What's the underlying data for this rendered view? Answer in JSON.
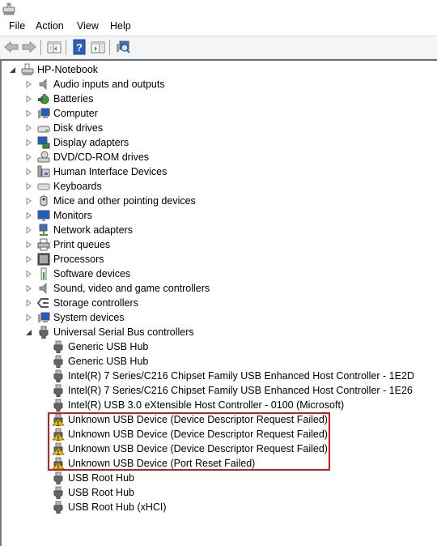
{
  "window": {
    "icon": "device-manager-icon"
  },
  "menu": [
    "File",
    "Action",
    "View",
    "Help"
  ],
  "toolbar": {
    "buttons": [
      {
        "name": "back-button",
        "icon": "back-arrow-icon"
      },
      {
        "name": "forward-button",
        "icon": "forward-arrow-icon"
      },
      {
        "name": "show-hide-console-tree-button",
        "icon": "console-tree-icon"
      },
      {
        "name": "help-button",
        "icon": "help-icon"
      },
      {
        "name": "show-hide-action-pane-button",
        "icon": "action-pane-icon"
      },
      {
        "name": "scan-hardware-changes-button",
        "icon": "scan-hardware-icon"
      }
    ]
  },
  "tree": {
    "root": {
      "label": "HP-Notebook",
      "expanded": true,
      "icon": "computer-root-icon"
    },
    "categories": [
      {
        "label": "Audio inputs and outputs",
        "icon": "speaker-icon"
      },
      {
        "label": "Batteries",
        "icon": "battery-icon"
      },
      {
        "label": "Computer",
        "icon": "computer-icon"
      },
      {
        "label": "Disk drives",
        "icon": "disk-drive-icon"
      },
      {
        "label": "Display adapters",
        "icon": "display-adapter-icon"
      },
      {
        "label": "DVD/CD-ROM drives",
        "icon": "dvd-drive-icon"
      },
      {
        "label": "Human Interface Devices",
        "icon": "hid-icon"
      },
      {
        "label": "Keyboards",
        "icon": "keyboard-icon"
      },
      {
        "label": "Mice and other pointing devices",
        "icon": "mouse-icon"
      },
      {
        "label": "Monitors",
        "icon": "monitor-icon"
      },
      {
        "label": "Network adapters",
        "icon": "network-adapter-icon"
      },
      {
        "label": "Print queues",
        "icon": "printer-icon"
      },
      {
        "label": "Processors",
        "icon": "processor-icon"
      },
      {
        "label": "Software devices",
        "icon": "software-device-icon"
      },
      {
        "label": "Sound, video and game controllers",
        "icon": "speaker-icon"
      },
      {
        "label": "Storage controllers",
        "icon": "storage-controller-icon"
      },
      {
        "label": "System devices",
        "icon": "system-device-icon"
      },
      {
        "label": "Universal Serial Bus controllers",
        "icon": "usb-plug-icon",
        "expanded": true
      }
    ],
    "usb_children": [
      {
        "label": "Generic USB Hub",
        "warning": false
      },
      {
        "label": "Generic USB Hub",
        "warning": false
      },
      {
        "label": "Intel(R) 7 Series/C216 Chipset Family USB Enhanced Host Controller - 1E2D",
        "warning": false
      },
      {
        "label": "Intel(R) 7 Series/C216 Chipset Family USB Enhanced Host Controller - 1E26",
        "warning": false
      },
      {
        "label": "Intel(R) USB 3.0 eXtensible Host Controller - 0100 (Microsoft)",
        "warning": false
      },
      {
        "label": "Unknown USB Device (Device Descriptor Request Failed)",
        "warning": true
      },
      {
        "label": "Unknown USB Device (Device Descriptor Request Failed)",
        "warning": true
      },
      {
        "label": "Unknown USB Device (Device Descriptor Request Failed)",
        "warning": true
      },
      {
        "label": "Unknown USB Device (Port Reset Failed)",
        "warning": true
      },
      {
        "label": "USB Root Hub",
        "warning": false
      },
      {
        "label": "USB Root Hub",
        "warning": false
      },
      {
        "label": "USB Root Hub (xHCI)",
        "warning": false
      }
    ]
  },
  "colors": {
    "highlight_border": "#d9151b",
    "warning_yellow": "#f5c400"
  }
}
